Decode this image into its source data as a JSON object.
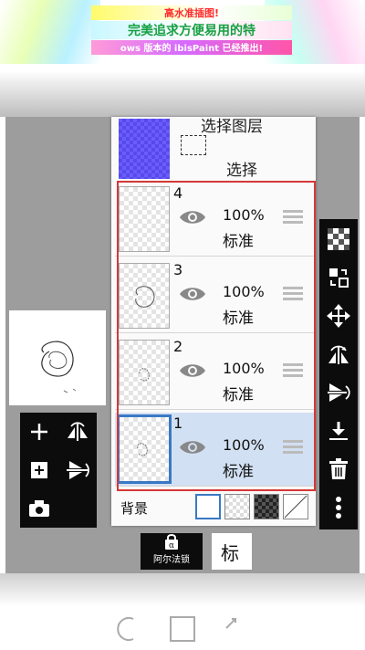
{
  "banner": {
    "line1": "高水准插图!",
    "line2": "完美追求方便易用的特",
    "line3": "ows 版本的 ibisPaint 已经推出!"
  },
  "selection_layer": {
    "title": "选择图层",
    "label": "选择"
  },
  "layers": [
    {
      "number": "4",
      "opacity": "100%",
      "blend": "标准",
      "selected": false
    },
    {
      "number": "3",
      "opacity": "100%",
      "blend": "标准",
      "selected": false
    },
    {
      "number": "2",
      "opacity": "100%",
      "blend": "标准",
      "selected": false
    },
    {
      "number": "1",
      "opacity": "100%",
      "blend": "标准",
      "selected": true
    }
  ],
  "background": {
    "label": "背景",
    "options": [
      "white",
      "transparent",
      "dark-checker",
      "none"
    ]
  },
  "bottom_bar": {
    "alpha_lock_label": "阿尔法锁",
    "alpha_symbol": "α",
    "blend_mode_value": "标"
  },
  "icons": {
    "left_tools": [
      "add-layer-icon",
      "flip-horizontal-icon",
      "add-image-layer-icon",
      "flip-vertical-icon",
      "camera-icon"
    ],
    "right_tools": [
      "transparency-icon",
      "layer-adjust-icon",
      "move-icon",
      "rotate-flip-icon",
      "flip-rotate-icon",
      "merge-down-icon",
      "trash-icon",
      "more-icon"
    ],
    "navbar": [
      "back-icon",
      "home-icon",
      "recents-icon"
    ]
  },
  "colors": {
    "selected_layer_bg": "#d2e0f3",
    "selection_thumb": "#6a5cff",
    "highlight_frame": "#d63838",
    "toolbar_bg": "#0c0c0c"
  }
}
